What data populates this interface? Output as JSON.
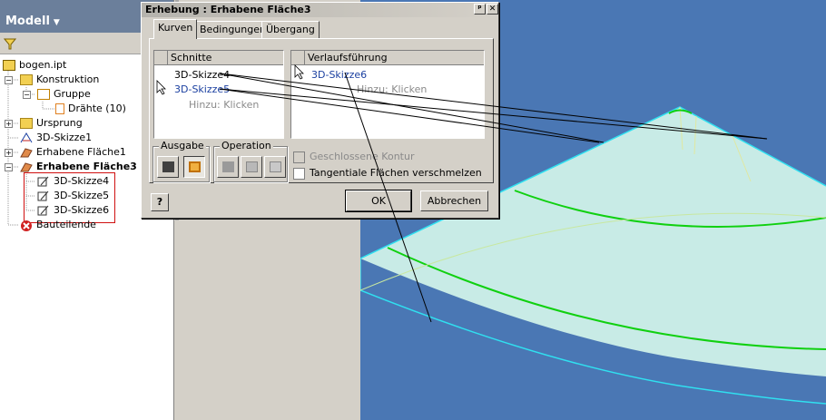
{
  "browser": {
    "title": "Modell",
    "items": [
      {
        "label": "bogen.ipt",
        "bold": false
      },
      {
        "label": "Konstruktion",
        "bold": false
      },
      {
        "label": "Gruppe",
        "bold": false
      },
      {
        "label": "Drähte (10)",
        "bold": false
      },
      {
        "label": "Ursprung",
        "bold": false
      },
      {
        "label": "3D-Skizze1",
        "bold": false
      },
      {
        "label": "Erhabene Fläche1",
        "bold": false
      },
      {
        "label": "Erhabene Fläche3",
        "bold": true
      },
      {
        "label": "3D-Skizze4",
        "bold": false
      },
      {
        "label": "3D-Skizze5",
        "bold": false
      },
      {
        "label": "3D-Skizze6",
        "bold": false
      },
      {
        "label": "Bauteilende",
        "bold": false
      }
    ]
  },
  "dialog": {
    "title": "Erhebung : Erhabene Fläche3",
    "tabs": [
      "Kurven",
      "Bedingungen",
      "Übergang"
    ],
    "sections": {
      "header": "Schnitte",
      "items": [
        "3D-Skizze4",
        "3D-Skizze5"
      ],
      "add_hint": "Hinzu: Klicken"
    },
    "rails": {
      "header": "Verlaufsführung",
      "items": [
        "3D-Skizze6"
      ],
      "add_hint": "Hinzu: Klicken"
    },
    "output_label": "Ausgabe",
    "operation_label": "Operation",
    "closed_loop_label": "Geschlossene Kontur",
    "merge_tangent_label": "Tangentiale Flächen verschmelzen",
    "ok_label": "OK",
    "cancel_label": "Abbrechen",
    "help_label": "?",
    "pin_label": "ᵖ",
    "close_label": "✕"
  },
  "icons": {
    "filter": "filter-icon",
    "part": "part-icon",
    "folder": "folder-icon",
    "sketch3d": "sketch3d-icon",
    "loft": "loft-icon",
    "end": "end-of-part-icon"
  },
  "colors": {
    "viewport_bg": "#4a77b4",
    "surface_fill": "#c8ebe6",
    "surface_edge": "#30e0f0",
    "sketch_curve": "#10d010",
    "selection_box": "#d01010"
  }
}
